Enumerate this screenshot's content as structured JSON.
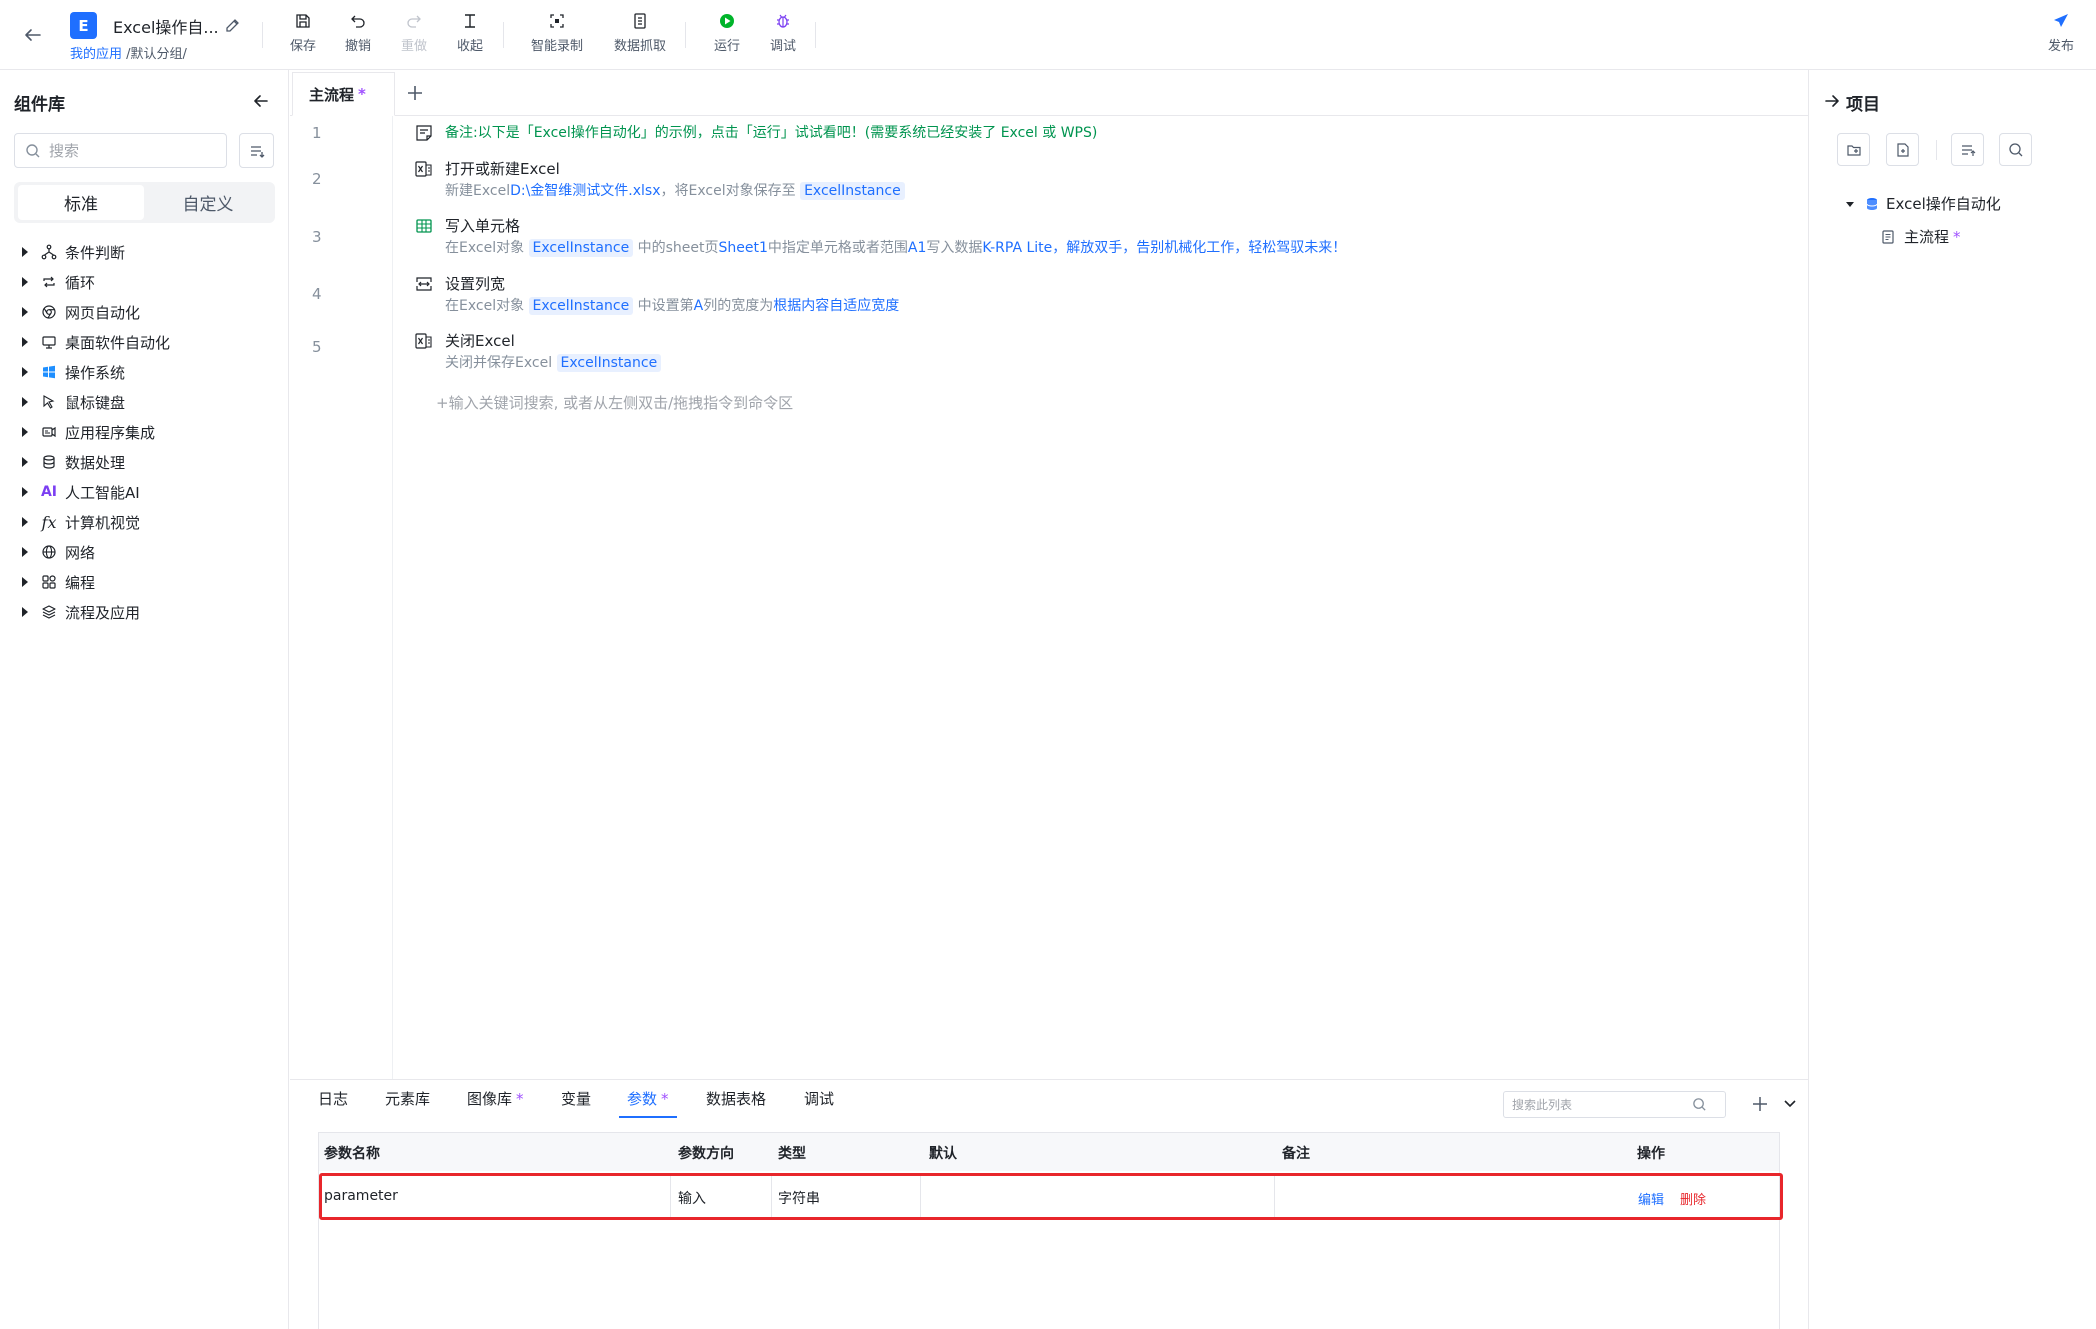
{
  "header": {
    "app_logo_letter": "E",
    "app_title": "Excel操作自...",
    "breadcrumb_app": "我的应用",
    "breadcrumb_group": " /默认分组/",
    "tools": {
      "save": "保存",
      "undo": "撤销",
      "redo": "重做",
      "collapse": "收起",
      "smart_record": "智能录制",
      "data_scrape": "数据抓取",
      "run": "运行",
      "debug": "调试"
    },
    "publish": "发布"
  },
  "library": {
    "title": "组件库",
    "search_placeholder": "搜索",
    "tabs": [
      "标准",
      "自定义"
    ],
    "categories": [
      {
        "label": "条件判断",
        "icon": "branch-icon"
      },
      {
        "label": "循环",
        "icon": "loop-icon"
      },
      {
        "label": "网页自动化",
        "icon": "browser-icon"
      },
      {
        "label": "桌面软件自动化",
        "icon": "desktop-icon"
      },
      {
        "label": "操作系统",
        "icon": "windows-icon"
      },
      {
        "label": "鼠标键盘",
        "icon": "cursor-icon"
      },
      {
        "label": "应用程序集成",
        "icon": "app-integration-icon"
      },
      {
        "label": "数据处理",
        "icon": "database-icon"
      },
      {
        "label": "人工智能AI",
        "icon": "ai-icon"
      },
      {
        "label": "计算机视觉",
        "icon": "function-icon"
      },
      {
        "label": "网络",
        "icon": "globe-icon"
      },
      {
        "label": "编程",
        "icon": "code-blocks-icon"
      },
      {
        "label": "流程及应用",
        "icon": "layers-icon"
      }
    ]
  },
  "editor": {
    "tab_label": "主流程",
    "tab_modified": "*",
    "line_numbers": [
      "1",
      "2",
      "3",
      "4",
      "5"
    ],
    "comment": "备注:以下是「Excel操作自动化」的示例，点击「运行」试试看吧！(需要系统已经安装了 Excel 或 WPS)",
    "steps": [
      {
        "title": "打开或新建Excel",
        "desc_prefix": "新建Excel",
        "desc_path": "D:\\金智维测试文件.xlsx",
        "desc_mid": "，将Excel对象保存至",
        "desc_var": "ExcelInstance"
      },
      {
        "title": "写入单元格",
        "desc_prefix": "在Excel对象",
        "desc_var": "ExcelInstance",
        "desc_mid1": "中的sheet页",
        "desc_sheet": "Sheet1",
        "desc_mid2": "中指定单元格或者范围",
        "desc_range": "A1",
        "desc_mid3": "写入数据",
        "desc_value": "K-RPA Lite，解放双手，告别机械化工作，轻松驾驭未来！"
      },
      {
        "title": "设置列宽",
        "desc_prefix": "在Excel对象",
        "desc_var": "ExcelInstance",
        "desc_mid1": "中设置第",
        "desc_col": "A",
        "desc_mid2": "列的宽度为",
        "desc_mode": "根据内容自适应宽度"
      },
      {
        "title": "关闭Excel",
        "desc_prefix": "关闭并保存Excel",
        "desc_var": "ExcelInstance"
      }
    ],
    "command_hint": "+输入关键词搜索, 或者从左侧双击/拖拽指令到命令区"
  },
  "bottom": {
    "tabs": [
      {
        "label": "日志",
        "star": ""
      },
      {
        "label": "元素库",
        "star": ""
      },
      {
        "label": "图像库",
        "star": "*"
      },
      {
        "label": "变量",
        "star": ""
      },
      {
        "label": "参数",
        "star": "*"
      },
      {
        "label": "数据表格",
        "star": ""
      },
      {
        "label": "调试",
        "star": ""
      }
    ],
    "search_placeholder": "搜索此列表",
    "table": {
      "headers": [
        "参数名称",
        "参数方向",
        "类型",
        "默认",
        "备注",
        "操作"
      ],
      "rows": [
        {
          "name": "parameter",
          "direction": "输入",
          "type": "字符串",
          "default": "",
          "note": "",
          "edit": "编辑",
          "delete": "删除"
        }
      ]
    }
  },
  "project": {
    "title": "项目",
    "root": "Excel操作自动化",
    "child": "主流程",
    "child_modified": "*"
  },
  "colors": {
    "accent": "#1f6fff",
    "comment": "#00944f",
    "modified": "#a051ff",
    "danger": "#e8262b",
    "run": "#00b42a"
  }
}
